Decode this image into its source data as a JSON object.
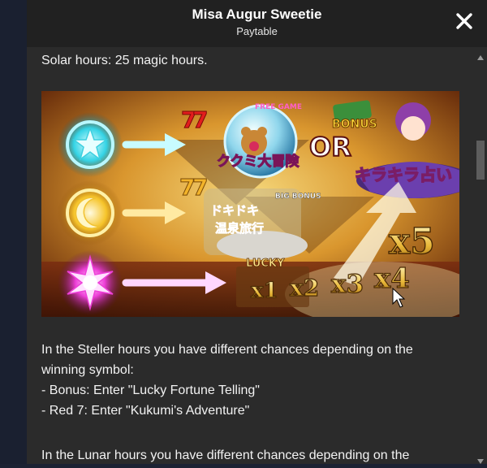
{
  "header": {
    "title": "Misa Augur Sweetie",
    "subtitle": "Paytable"
  },
  "content": {
    "solar_line": "Solar hours: 25 magic hours.",
    "artwork": {
      "free_game_label": "FREE GAME",
      "free_game_title": "ククミ大冒険",
      "or_label": "OR",
      "bonus_label": "BONUS",
      "bonus_title": "キラキラ占い",
      "big_bonus_label": "BIG BONUS",
      "big_bonus_title_1": "ドキドキ",
      "big_bonus_title_2": "温泉旅行",
      "lucky_label": "LUCKY",
      "multipliers": [
        "x1",
        "x2",
        "x3",
        "x4",
        "x5"
      ]
    },
    "paragraph_lines": [
      "In the Steller hours you have different chances depending on the",
      "winning symbol:",
      "- Bonus: Enter \"Lucky Fortune Telling\"",
      "- Red 7: Enter \"Kukumi's Adventure\"",
      "",
      "In the Lunar hours you have different chances depending on the"
    ]
  },
  "icons": {
    "close": "close-x-icon",
    "scroll_up": "arrow-up-icon",
    "scroll_down": "arrow-down-icon"
  },
  "colors": {
    "panel_bg": "#2b2b2b",
    "header_bg": "#212121",
    "page_bg": "#1c2233"
  }
}
